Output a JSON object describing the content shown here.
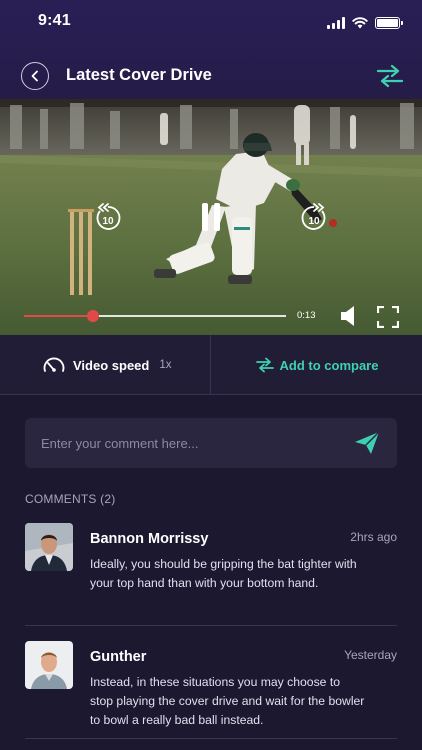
{
  "status_bar": {
    "time": "9:41"
  },
  "header": {
    "title": "Latest Cover Drive"
  },
  "player": {
    "elapsed": "0:13",
    "progress_fraction": 0.265,
    "rewind_seconds": "10",
    "forward_seconds": "10"
  },
  "actions": {
    "speed_label": "Video speed",
    "speed_value": "1x",
    "compare_label": "Add to compare"
  },
  "comment_input": {
    "placeholder": "Enter your comment here..."
  },
  "comments": {
    "header": "COMMENTS (2)",
    "items": [
      {
        "name": "Bannon Morrissy",
        "time": "2hrs ago",
        "text": "Ideally, you should be gripping the bat tighter with your top hand than with your bottom hand."
      },
      {
        "name": "Gunther",
        "time": "Yesterday",
        "text": "Instead, in these situations you may choose to stop playing the cover drive and wait for the bowler to bowl a really bad ball instead."
      }
    ]
  },
  "colors": {
    "accent": "#3fd0b2",
    "progress": "#e24a4a",
    "header_bg": "#2a1f55",
    "page_bg": "#1c1830"
  },
  "icons": {
    "back": "chevron-left-icon",
    "swap": "swap-arrows-icon",
    "rewind": "rewind-10-icon",
    "pause": "pause-icon",
    "forward": "forward-10-icon",
    "volume": "volume-icon",
    "fullscreen": "fullscreen-icon",
    "speed": "speedometer-icon",
    "compare": "swap-arrows-icon",
    "send": "send-icon"
  }
}
